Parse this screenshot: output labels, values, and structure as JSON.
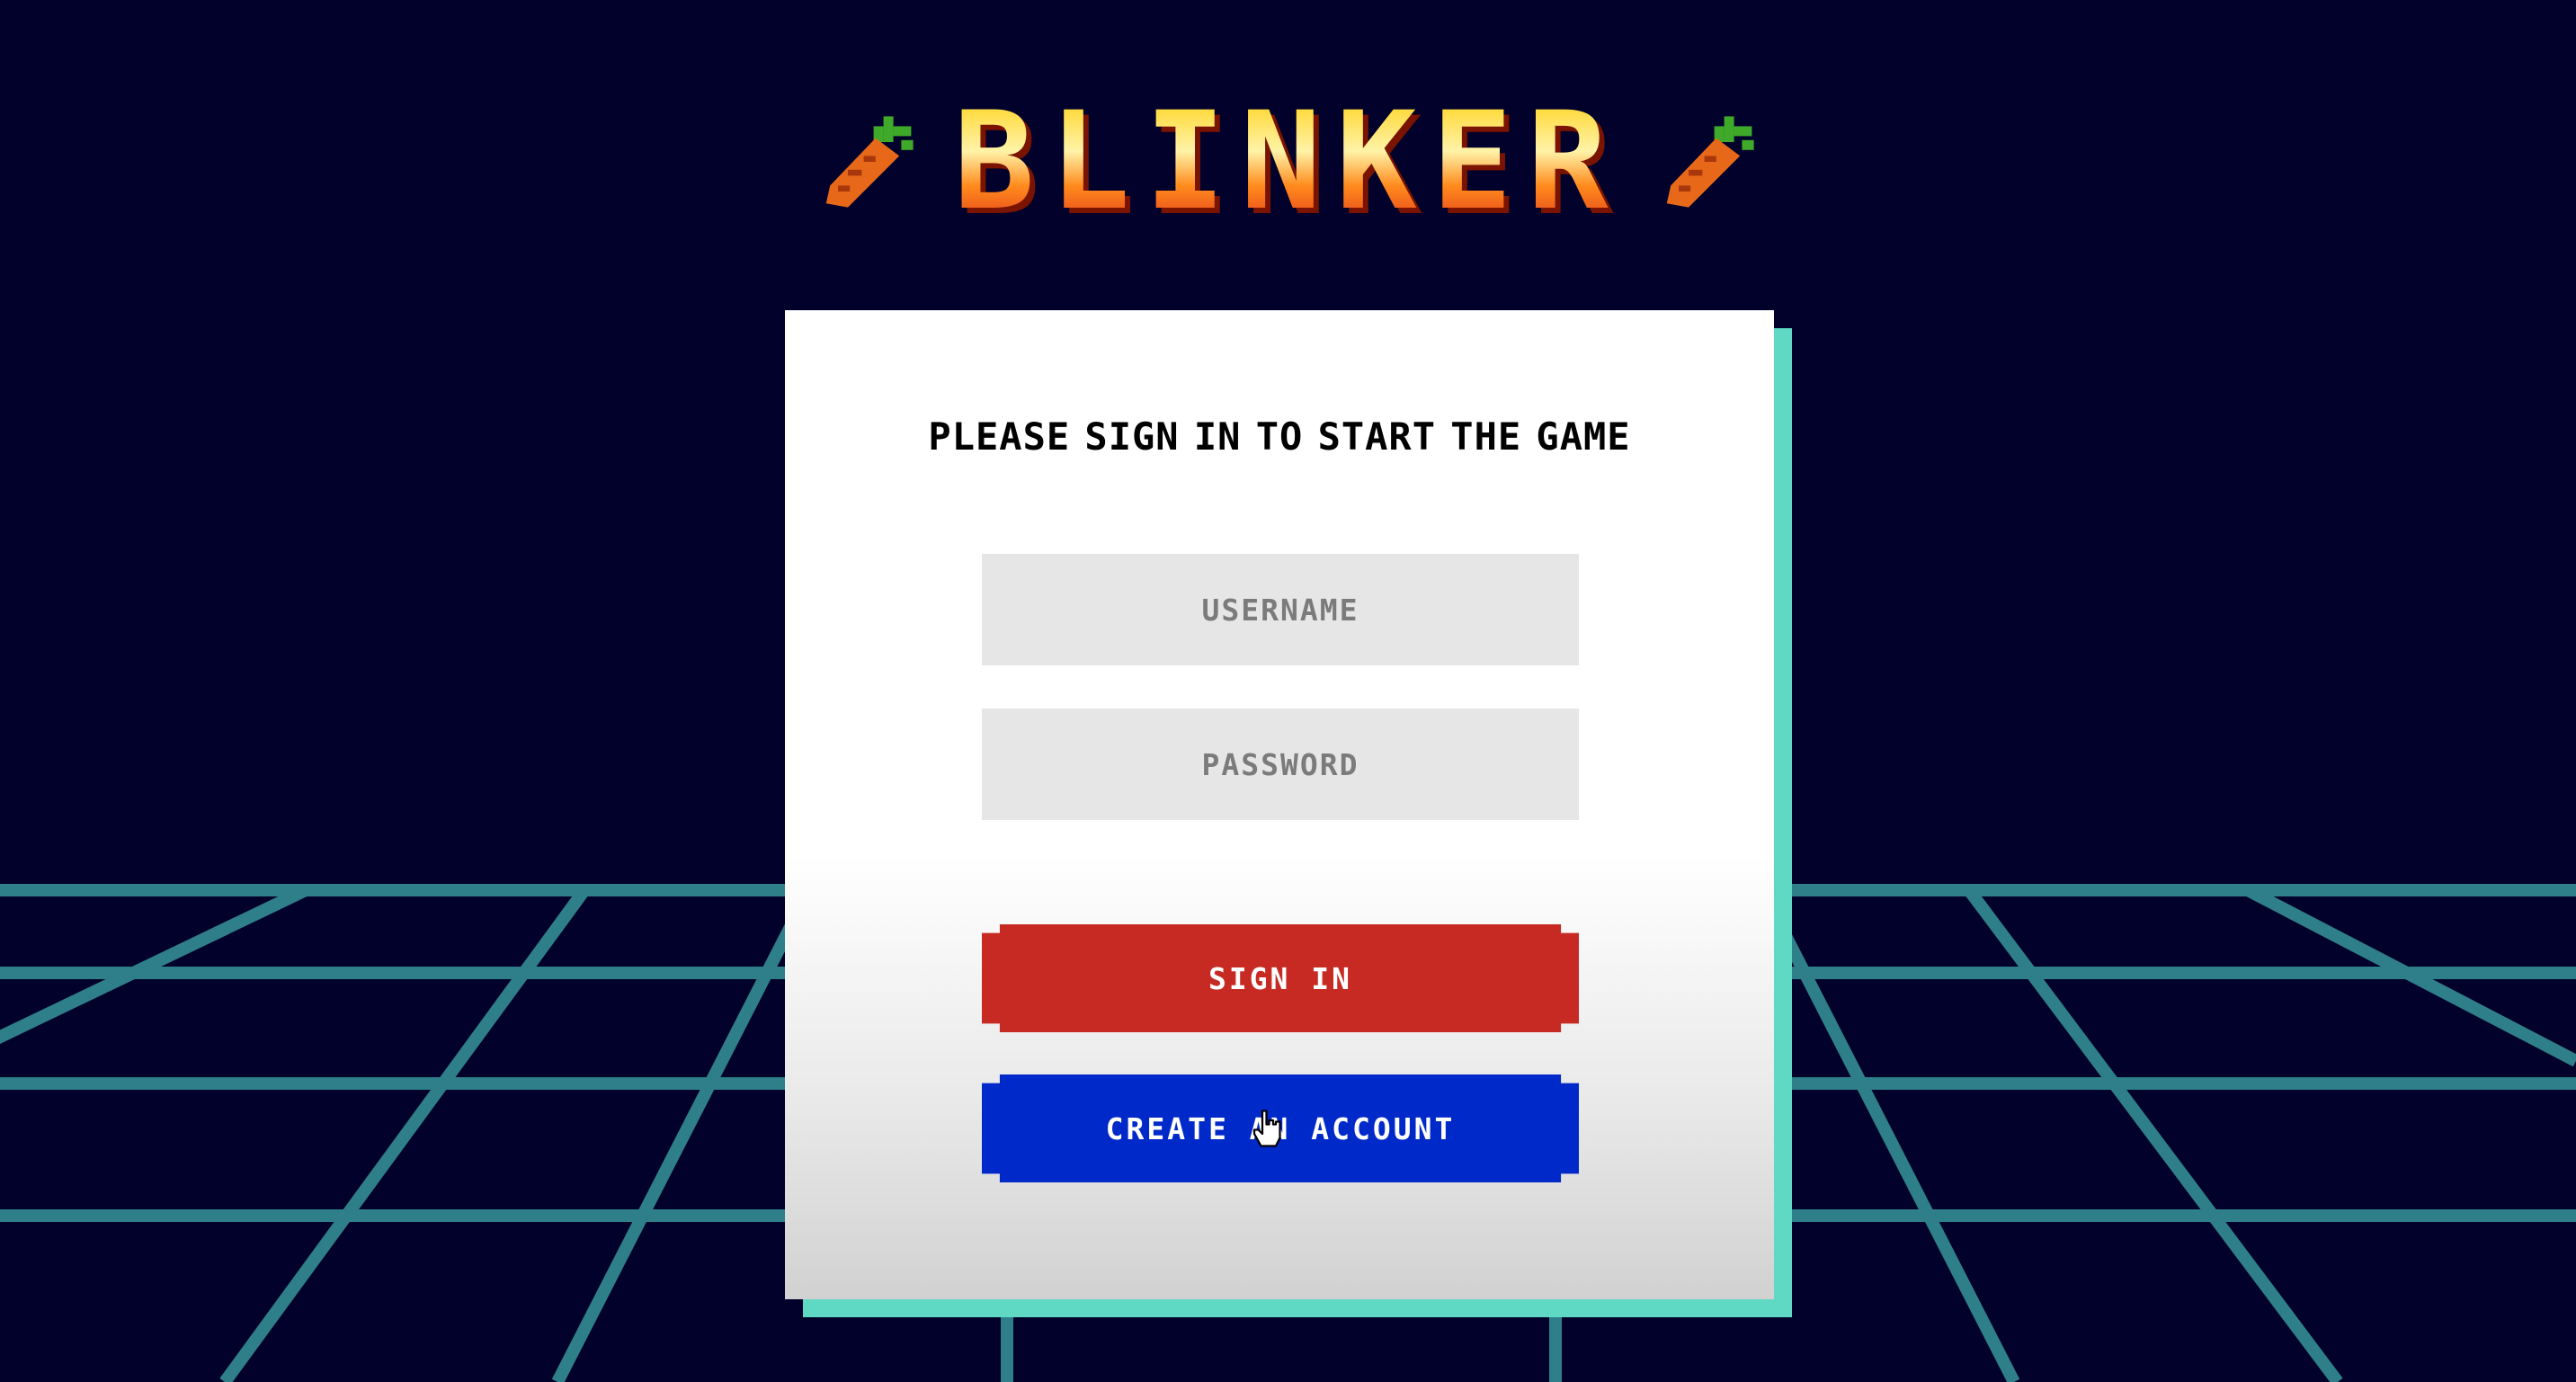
{
  "logo": {
    "title": "BLINKER",
    "icon_left": "carrot-icon",
    "icon_right": "carrot-icon"
  },
  "login": {
    "prompt": "PLEASE SIGN IN TO START THE GAME",
    "username_placeholder": "USERNAME",
    "password_placeholder": "PASSWORD",
    "sign_in_label": "SIGN IN",
    "create_account_label": "CREATE AN ACCOUNT"
  },
  "colors": {
    "background": "#01012b",
    "grid": "#2e7f8a",
    "panel_shadow": "#5fd9c4",
    "sign_in": "#c62a22",
    "create_account": "#0029c9",
    "input_fill": "#e6e6e6"
  },
  "cursor": "hand-pointer-icon"
}
